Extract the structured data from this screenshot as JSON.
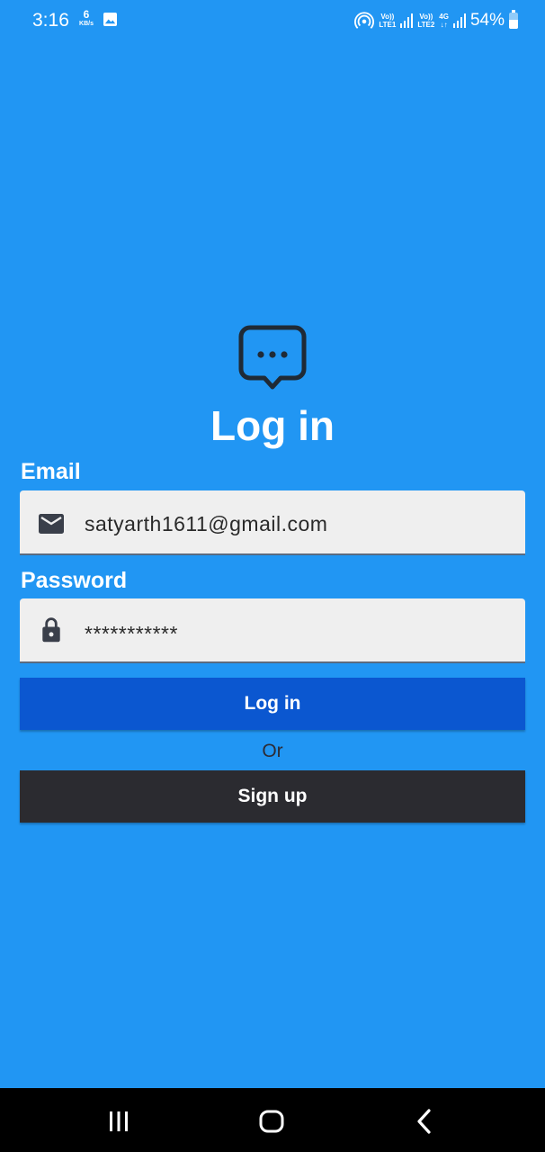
{
  "status_bar": {
    "time": "3:16",
    "speed_value": "6",
    "speed_unit": "KB/s",
    "sim1_label_top": "Vo))",
    "sim1_label_bottom": "LTE1",
    "sim2_label_top": "Vo))",
    "sim2_label_bottom": "LTE2",
    "network_type": "4G",
    "network_arrows": "↓↑",
    "battery_percent": "54%",
    "battery_level": 0.54
  },
  "login": {
    "logo_icon": "chat-bubble-icon",
    "title": "Log in",
    "email_label": "Email",
    "email_icon": "mail-icon",
    "email_value": "satyarth1611@gmail.com",
    "password_label": "Password",
    "password_icon": "lock-icon",
    "password_value": "***********",
    "login_button": "Log in",
    "or_text": "Or",
    "signup_button": "Sign up"
  },
  "nav_bar": {
    "recents_icon": "recents-icon",
    "home_icon": "home-icon",
    "back_icon": "back-icon"
  },
  "colors": {
    "background": "#2196f3",
    "login_button": "#0b57d0",
    "signup_button": "#2b2b30",
    "input_background": "#efefef"
  }
}
